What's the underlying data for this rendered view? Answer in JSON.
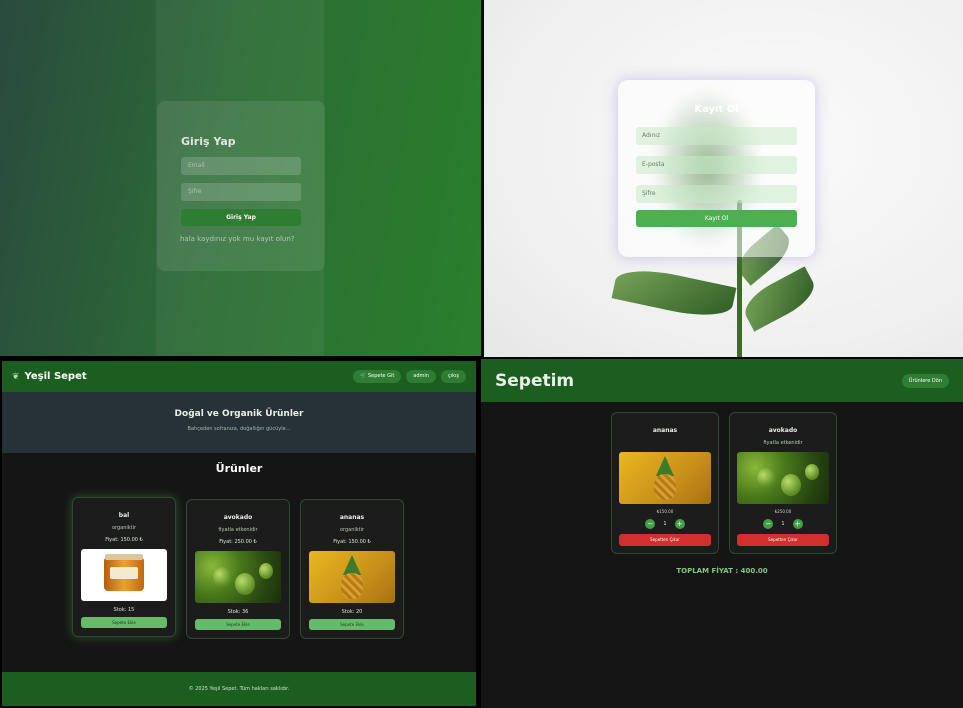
{
  "login": {
    "title": "Giriş Yap",
    "email_placeholder": "Email",
    "password_placeholder": "Şifre",
    "submit_label": "Giriş Yap",
    "register_link": "hala kaydınız yok mu kayıt olun?"
  },
  "register": {
    "title": "Kayıt Ol",
    "name_placeholder": "Adınız",
    "email_placeholder": "E-posta",
    "password_placeholder": "Şifre",
    "submit_label": "Kayıt Ol"
  },
  "shop": {
    "brand": "Yeşil Sepet",
    "nav": [
      "Sepete Git",
      "admin",
      "çıkış"
    ],
    "hero_title": "Doğal ve Organik Ürünler",
    "hero_subtitle": "Bahçeden sofranıza, doğallığın gücüyle...",
    "section_title": "Ürünler",
    "products": [
      {
        "name": "bal",
        "desc": "organiktir",
        "price": "Fiyat: 150.00 ₺",
        "stock": "Stok: 15",
        "button": "Sepete Ekle"
      },
      {
        "name": "avokado",
        "desc": "fiyatla etkenidir",
        "price": "Fiyat: 250.00 ₺",
        "stock": "Stok: 36",
        "button": "Sepete Ekle"
      },
      {
        "name": "ananas",
        "desc": "organiktir",
        "price": "Fiyat: 150.00 ₺",
        "stock": "Stok: 20",
        "button": "Sepete Ekle"
      }
    ],
    "footer": "© 2025 Yeşil Sepet. Tüm hakları saklıdır."
  },
  "cart": {
    "title": "Sepetim",
    "back_button": "Ürünlere Dön",
    "items": [
      {
        "name": "ananas",
        "desc": "",
        "price": "₺150.00",
        "qty": "1",
        "remove": "Sepetten Çıkar"
      },
      {
        "name": "avokado",
        "desc": "fiyatla etkenidir",
        "price": "₺250.00",
        "qty": "1",
        "remove": "Sepetten Çıkar"
      }
    ],
    "total": "TOPLAM FİYAT : 400.00"
  }
}
